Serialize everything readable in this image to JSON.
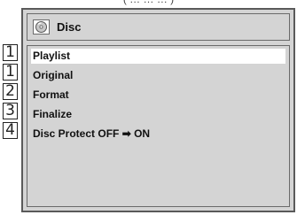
{
  "header_fragment": "( … … … )",
  "window": {
    "title": "Disc",
    "icon": "disc-icon"
  },
  "menu": {
    "items": [
      {
        "label": "Playlist",
        "selected": true
      },
      {
        "label": "Original",
        "selected": false
      },
      {
        "label": "Format",
        "selected": false
      },
      {
        "label": "Finalize",
        "selected": false
      },
      {
        "label": "Disc Protect OFF ➡ ON",
        "selected": false
      }
    ]
  },
  "step_markers": [
    "1",
    "1",
    "2",
    "3",
    "4"
  ],
  "colors": {
    "panel_bg": "#d4d4d4",
    "border": "#5a5a5a",
    "selected_bg": "#ffffff"
  }
}
